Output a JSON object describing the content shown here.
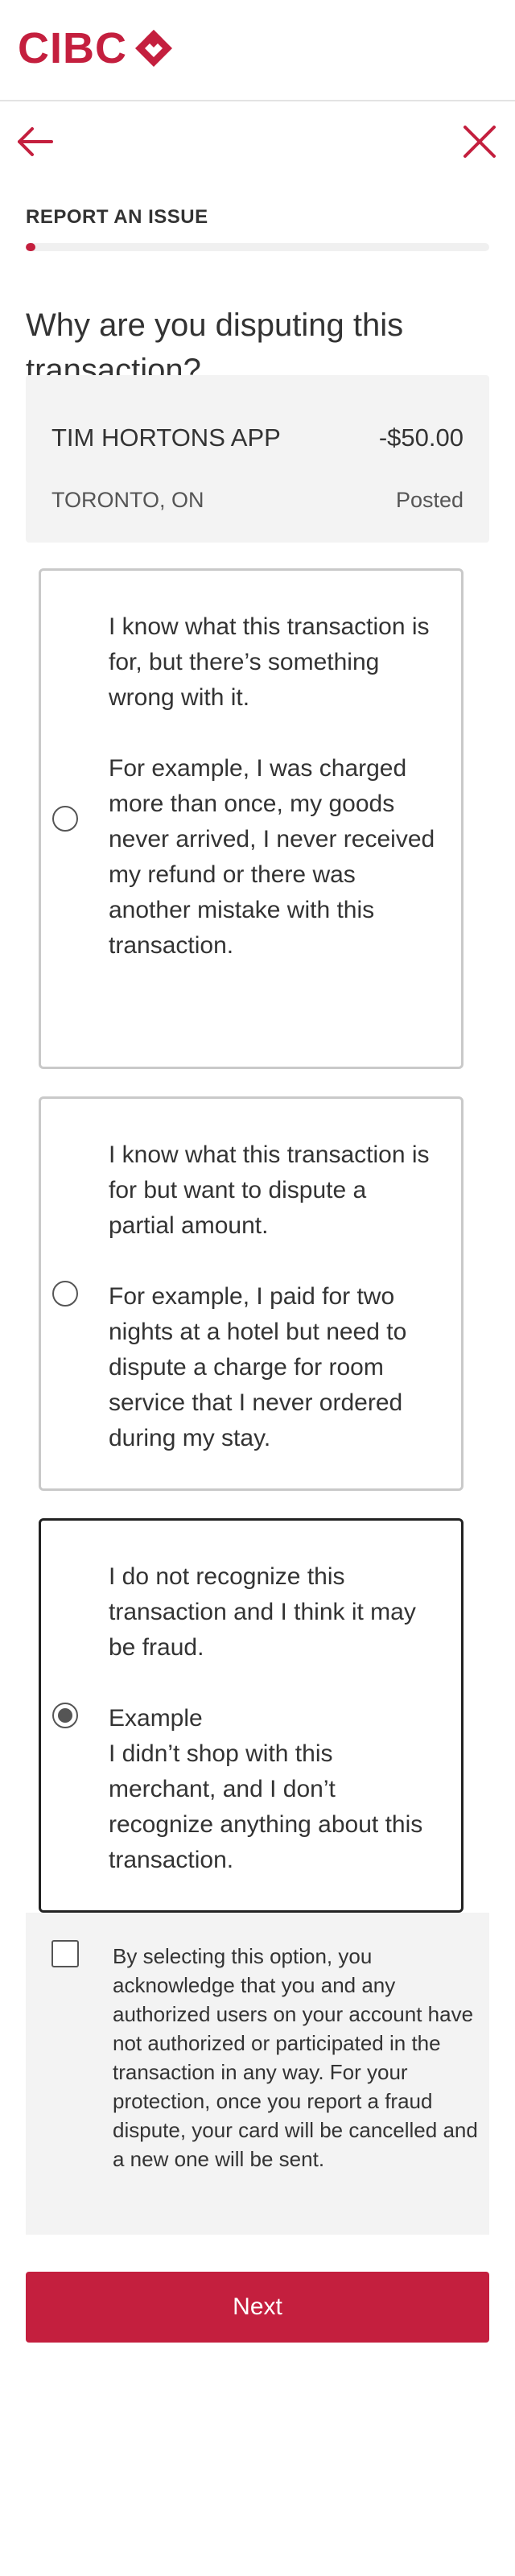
{
  "brand": {
    "logo_text": "CIBC",
    "logo_icon": "cibc-diamond-logo",
    "accent_color": "#c41f3e"
  },
  "nav": {
    "back_icon": "arrow-left-icon",
    "close_icon": "close-icon"
  },
  "flow": {
    "section_label": "REPORT AN ISSUE",
    "progress_fraction": 0.02
  },
  "question": "Why are you disputing this transaction?",
  "transaction": {
    "merchant": "TIM HORTONS APP",
    "amount": "-$50.00",
    "location": "TORONTO, ON",
    "status": "Posted"
  },
  "options": [
    {
      "title": "I know what this transaction is for, but there’s something wrong with it.",
      "detail": "For example, I was charged more than once, my goods never arrived, I never received my refund or there was another mistake with this transaction.",
      "selected": false
    },
    {
      "title": "I know what this transaction is for but want to dispute a partial amount.",
      "detail": "For example, I paid for two nights at a hotel but need to dispute a charge for room service that I never ordered during my stay.",
      "selected": false
    },
    {
      "title": "I do not recognize this transaction and I think it may be fraud.",
      "detail": "Example\nI didn’t shop with this merchant, and I don’t recognize anything about this transaction.",
      "selected": true
    }
  ],
  "acknowledgement": {
    "checked": false,
    "text": "By selecting this option, you acknowledge that you and any authorized users on your account have not authorized or participated in the transaction in any way. For your protection, once you report a fraud dispute, your card will be cancelled and a new one will be sent."
  },
  "next_label": "Next"
}
